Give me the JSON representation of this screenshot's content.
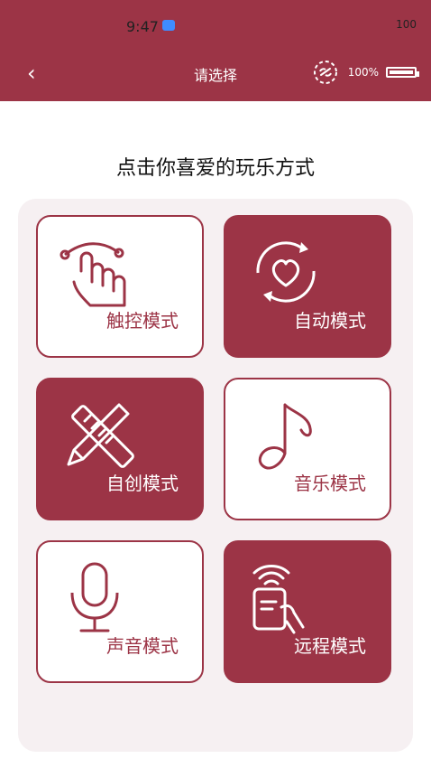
{
  "status": {
    "time": "9:47",
    "battery": "100"
  },
  "nav": {
    "title": "请选择",
    "back_icon": "chevron-left-icon"
  },
  "device": {
    "battery_pct": "100%"
  },
  "headline": "点击你喜爱的玩乐方式",
  "colors": {
    "accent": "#9c3446",
    "panel": "#f6f0f2"
  },
  "modes": [
    {
      "label": "触控模式",
      "icon": "touch-hand-icon",
      "filled": false
    },
    {
      "label": "自动模式",
      "icon": "heart-cycle-icon",
      "filled": true
    },
    {
      "label": "自创模式",
      "icon": "ruler-pencil-icon",
      "filled": true
    },
    {
      "label": "音乐模式",
      "icon": "music-note-icon",
      "filled": false
    },
    {
      "label": "声音模式",
      "icon": "microphone-icon",
      "filled": false
    },
    {
      "label": "远程模式",
      "icon": "remote-phone-icon",
      "filled": true
    }
  ]
}
